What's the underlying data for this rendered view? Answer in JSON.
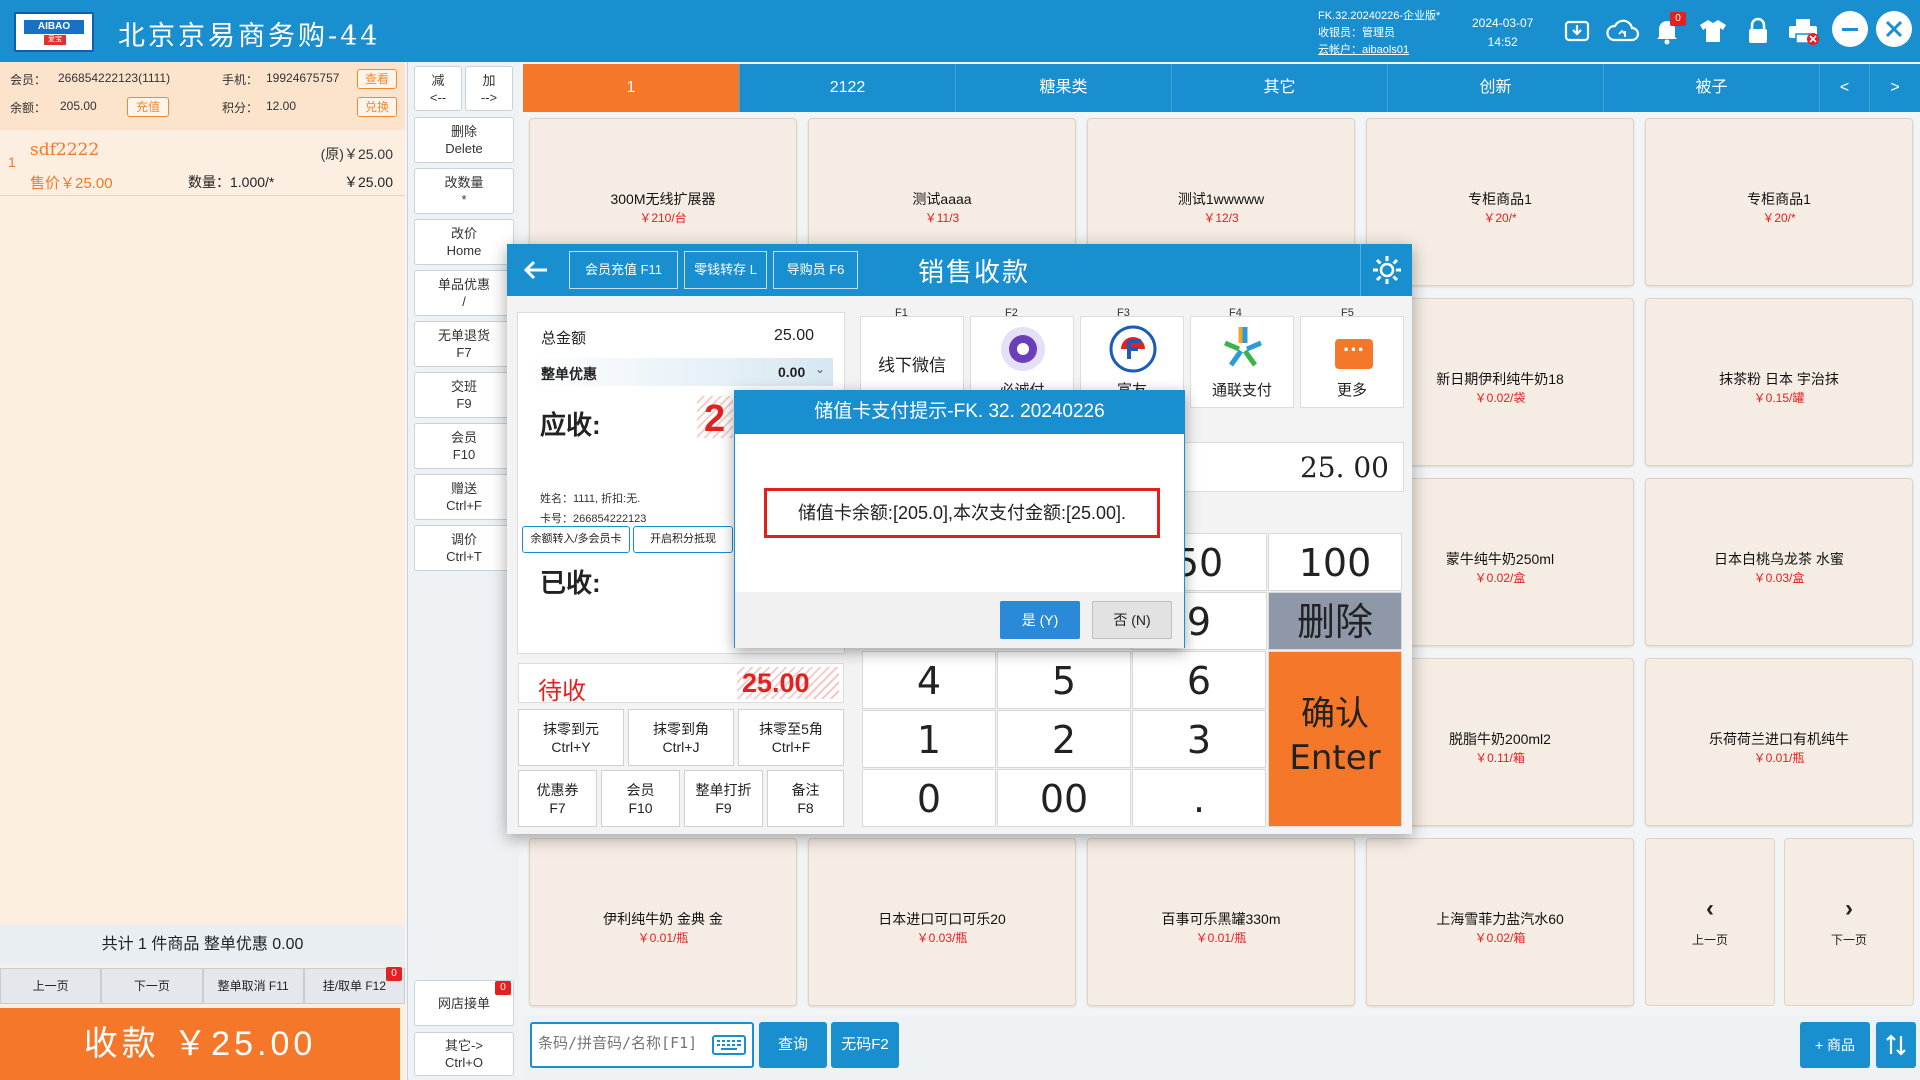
{
  "header": {
    "logo_text": "AIBAO",
    "logo_sub": "爱宝",
    "store_name": "北京京易商务购-44",
    "version": "FK.32.20240226-企业版*",
    "cashier": "收银员：管理员",
    "cloud_account": "云帐户：aibaols01",
    "date": "2024-03-07",
    "time": "14:52",
    "notify_badge": "0"
  },
  "member": {
    "id_label": "会员：",
    "id": "266854222123(1111)",
    "phone_label": "手机：",
    "phone": "19924675757",
    "view_btn": "查看",
    "balance_label": "余额：",
    "balance": "205.00",
    "recharge_btn": "充值",
    "points_label": "积分：",
    "points": "12.00",
    "exchange_btn": "兑换"
  },
  "cart": {
    "items": [
      {
        "index": "1",
        "name": "sdf2222",
        "orig_price": "(原)￥25.00",
        "sale_price": "售价￥25.00",
        "qty": "数量：1.000/*",
        "amount": "￥25.00"
      }
    ],
    "summary": "共计 1 件商品  整单优惠 0.00",
    "buttons": [
      "上一页",
      "下一页",
      "整单取消 F11",
      "挂/取单 F12"
    ],
    "hold_badge": "0",
    "pay_button": "收款  ￥25.00"
  },
  "mid_buttons": {
    "minus": [
      "减",
      "<--"
    ],
    "plus": [
      "加",
      "-->"
    ],
    "list": [
      [
        "删除",
        "Delete"
      ],
      [
        "改数量",
        "*"
      ],
      [
        "改价",
        "Home"
      ],
      [
        "单品优惠",
        "/"
      ],
      [
        "无单退货",
        "F7"
      ],
      [
        "交班",
        "F9"
      ],
      [
        "会员",
        "F10"
      ],
      [
        "赠送",
        "Ctrl+F"
      ],
      [
        "调价",
        "Ctrl+T"
      ]
    ],
    "online_orders": "网店接单",
    "online_badge": "0",
    "other": [
      "其它->",
      "Ctrl+O"
    ]
  },
  "categories": [
    "1",
    "2122",
    "糖果类",
    "其它",
    "创新",
    "被子",
    "<",
    ">"
  ],
  "products": [
    {
      "name": "300M无线扩展器",
      "price": "￥210/台"
    },
    {
      "name": "测试aaaa",
      "price": "￥11/3"
    },
    {
      "name": "测试1wwwww",
      "price": "￥12/3"
    },
    {
      "name": "专柜商品1",
      "price": "￥20/*"
    },
    {
      "name": "专柜商品1",
      "price": "￥20/*"
    },
    {
      "name": "新日期伊利纯牛奶18",
      "price": "￥0.02/袋"
    },
    {
      "name": "抹茶粉 日本 宇治抹",
      "price": "￥0.15/罐"
    },
    {
      "name": "蒙牛纯牛奶250ml",
      "price": "￥0.02/盒"
    },
    {
      "name": "日本白桃乌龙茶 水蜜",
      "price": "￥0.03/盒"
    },
    {
      "name": "脱脂牛奶200ml2",
      "price": "￥0.11/箱"
    },
    {
      "name": "乐荷荷兰进口有机纯牛",
      "price": "￥0.01/瓶"
    },
    {
      "name": "伊利纯牛奶 金典 金",
      "price": "￥0.01/瓶"
    },
    {
      "name": "日本进口可口可乐20",
      "price": "￥0.03/瓶"
    },
    {
      "name": "百事可乐黑罐330m",
      "price": "￥0.01/瓶"
    },
    {
      "name": "上海雪菲力盐汽水60",
      "price": "￥0.02/箱"
    }
  ],
  "product_nav": {
    "prev": "上一页",
    "next": "下一页"
  },
  "bottom": {
    "search_placeholder": "条码/拼音码/名称[F1]",
    "query_btn": "查询",
    "nocode_btn": "无码F2",
    "add_product_btn": "+ 商品"
  },
  "payment": {
    "title": "销售收款",
    "head_buttons": [
      "会员充值 F11",
      "零钱转存 L",
      "导购员 F6"
    ],
    "total_label": "总金额",
    "total": "25.00",
    "discount_label": "整单优惠",
    "discount": "0.00",
    "due_label": "应收:",
    "due_value": "2",
    "member_name": "姓名：1111, 折扣:无.",
    "member_card": "卡号：266854222123",
    "balance_transfer_btn": "余额转入/多会员卡",
    "points_offset_btn": "开启积分抵现",
    "received_label": "已收:",
    "pending_label": "待收",
    "pending_value": "25.00",
    "methods": [
      {
        "key": "F1",
        "label": "线下微信"
      },
      {
        "key": "F2",
        "label": "必诚付"
      },
      {
        "key": "F3",
        "label": "富友"
      },
      {
        "key": "F4",
        "label": "通联支付"
      },
      {
        "key": "F5",
        "label": "更多"
      }
    ],
    "amount_input": "25. 00",
    "round_buttons": [
      [
        "抹零到元",
        "Ctrl+Y"
      ],
      [
        "抹零到角",
        "Ctrl+J"
      ],
      [
        "抹零至5角",
        "Ctrl+F"
      ]
    ],
    "extra_buttons": [
      [
        "优惠券",
        "F7"
      ],
      [
        "会员",
        "F10"
      ],
      [
        "整单打折",
        "F9"
      ],
      [
        "备注",
        "F8"
      ]
    ],
    "keys": {
      "k50": "50",
      "k100": "100",
      "k9": "9",
      "del": "删除",
      "k4": "4",
      "k5": "5",
      "k6": "6",
      "k1": "1",
      "k2": "2",
      "k3": "3",
      "k0": "0",
      "k00": "00",
      "dot": ".",
      "confirm": "确认",
      "enter": "Enter"
    }
  },
  "alert": {
    "title": "储值卡支付提示-FK. 32. 20240226",
    "message": "储值卡余额:[205.0],本次支付金额:[25.00].",
    "yes": "是 (Y)",
    "no": "否 (N)"
  },
  "colors": {
    "primary": "#1a8fd0",
    "accent": "#f5782a",
    "price_red": "#e52020"
  }
}
